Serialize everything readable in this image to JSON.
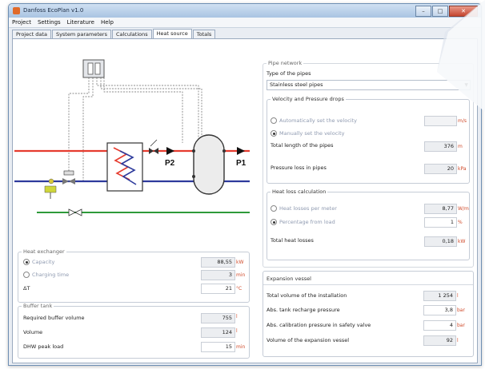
{
  "window": {
    "title": "Danfoss EcoPlan v1.0"
  },
  "menu": [
    "Project",
    "Settings",
    "Literature",
    "Help"
  ],
  "tabs": [
    {
      "label": "Project data",
      "active": false
    },
    {
      "label": "System parameters",
      "active": false
    },
    {
      "label": "Calculations",
      "active": false
    },
    {
      "label": "Heat source",
      "active": true
    },
    {
      "label": "Totals",
      "active": false
    }
  ],
  "diagram": {
    "p1": "P1",
    "p2": "P2",
    "colors": {
      "hot": "#e63b2e",
      "cold": "#2d3a9c",
      "return": "#2e9a3a"
    }
  },
  "heat_exchanger": {
    "legend": "Heat exchanger",
    "capacity": {
      "label": "Capacity",
      "value": "88,55",
      "unit": "kW"
    },
    "charging_time": {
      "label": "Charging time",
      "value": "3",
      "unit": "min"
    },
    "dt": {
      "label": "ΔT",
      "value": "21",
      "unit": "°C"
    }
  },
  "buffer_tank": {
    "legend": "Buffer tank",
    "required": {
      "label": "Required buffer volume",
      "value": "755",
      "unit": "l"
    },
    "volume": {
      "label": "Volume",
      "value": "124",
      "unit": "l"
    },
    "peak": {
      "label": "DHW peak load",
      "value": "15",
      "unit": "min"
    }
  },
  "pipe_network": {
    "legend": "Pipe network",
    "type_label": "Type of the pipes",
    "type_value": "Stainless steel pipes"
  },
  "velocity": {
    "legend": "Velocity and Pressure drops",
    "auto_label": "Automatically set the velocity",
    "auto_unit": "m/s",
    "manual_label": "Manually set the velocity",
    "length": {
      "label": "Total length of the pipes",
      "value": "376",
      "unit": "m"
    },
    "pressure": {
      "label": "Pressure loss in pipes",
      "value": "20",
      "unit": "kPa"
    }
  },
  "heat_loss": {
    "legend": "Heat loss calculation",
    "per_meter": {
      "label": "Heat losses per meter",
      "value": "8,77",
      "unit": "W/m"
    },
    "percentage": {
      "label": "Percentage from load",
      "value": "1",
      "unit": "%"
    },
    "total": {
      "label": "Total heat losses",
      "value": "0,18",
      "unit": "kW"
    }
  },
  "expansion": {
    "legend": "Expansion vessel",
    "volume": {
      "label": "Total volume of the installation",
      "value": "1 254",
      "unit": "l"
    },
    "recharge": {
      "label": "Abs. tank recharge pressure",
      "value": "3,8",
      "unit": "bar"
    },
    "calibration": {
      "label": "Abs. calibration pressure in safety valve",
      "value": "4",
      "unit": "bar"
    },
    "vessel": {
      "label": "Volume of the expansion vessel",
      "value": "92",
      "unit": "l"
    }
  }
}
